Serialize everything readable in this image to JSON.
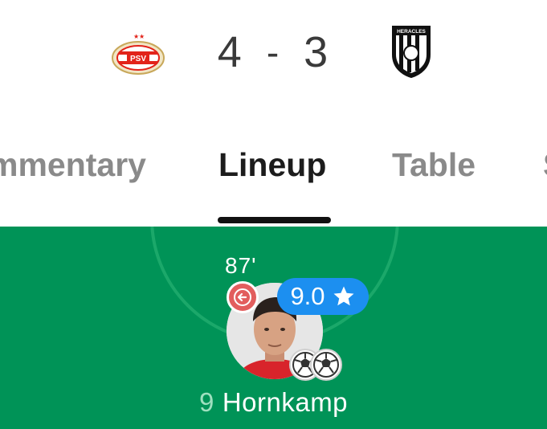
{
  "match": {
    "home_team_crest_text": "PSV",
    "away_team_crest_text": "HERACLES",
    "home_score": "4",
    "separator": "-",
    "away_score": "3"
  },
  "tabs": [
    {
      "label": "Commentary",
      "visible_text": "mmentary",
      "active": false
    },
    {
      "label": "Lineup",
      "visible_text": "Lineup",
      "active": true
    },
    {
      "label": "Table",
      "visible_text": "Table",
      "active": false
    },
    {
      "label": "Stats",
      "visible_text": "S",
      "active": false
    }
  ],
  "player": {
    "substitution_minute": "87'",
    "rating": "9.0",
    "number": "9",
    "name": "Hornkamp",
    "goals": 2
  },
  "colors": {
    "pitch": "#009357",
    "rating_badge": "#1c8ff0",
    "sub_badge": "#e25e5e",
    "active_tab": "#1c1c1c",
    "inactive_tab": "#8a8a8a"
  },
  "icons": [
    "psv-crest-icon",
    "heracles-crest-icon",
    "substitution-out-icon",
    "star-icon",
    "football-icon"
  ]
}
